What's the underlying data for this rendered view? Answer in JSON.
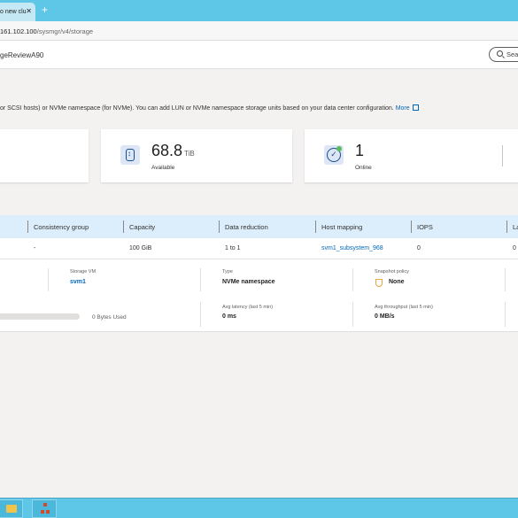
{
  "browser": {
    "tab_title": "o new clu",
    "tab_close": "✕",
    "new_tab": "+",
    "url_host": "161.102.100",
    "url_path": "/sysmgr/v4/storage"
  },
  "header": {
    "cluster_name": "geReviewA90",
    "search_placeholder": "Sea"
  },
  "description": {
    "text": "or SCSI hosts) or NVMe namespace (for NVMe). You can add LUN or NVMe namespace storage units based on your data center configuration.",
    "more_link": "More"
  },
  "summary_cards": {
    "available": {
      "value": "68.8",
      "unit": "TiB",
      "label": "Available"
    },
    "online": {
      "value": "1",
      "label": "Online"
    }
  },
  "table": {
    "columns": [
      "Consistency group",
      "Capacity",
      "Data reduction",
      "Host mapping",
      "IOPS",
      "La"
    ],
    "row": {
      "consistency_group": "-",
      "capacity": "100 GiB",
      "data_reduction": "1 to 1",
      "host_mapping": "svm1_subsystem_968",
      "iops": "0",
      "latency": "0"
    }
  },
  "detail": {
    "storage_vm_label": "Storage VM",
    "storage_vm_value": "svm1",
    "type_label": "Type",
    "type_value": "NVMe namespace",
    "snapshot_label": "Snapshot policy",
    "snapshot_value": "None",
    "latency_label": "Avg latency (last 5 min)",
    "latency_value": "0 ms",
    "throughput_label": "Avg throughput (last 5 min)",
    "throughput_value": "0 MB/s",
    "used_text": "0 Bytes Used",
    "used_fraction": 0
  },
  "colors": {
    "accent": "#0067b8",
    "taskbar": "#5ec6e6",
    "table_header": "#dceefb"
  },
  "icons": [
    "close-icon",
    "plus-icon",
    "search-icon",
    "external-link-icon",
    "database-icon",
    "online-check-icon",
    "shield-icon",
    "folder-icon",
    "network-icon"
  ]
}
